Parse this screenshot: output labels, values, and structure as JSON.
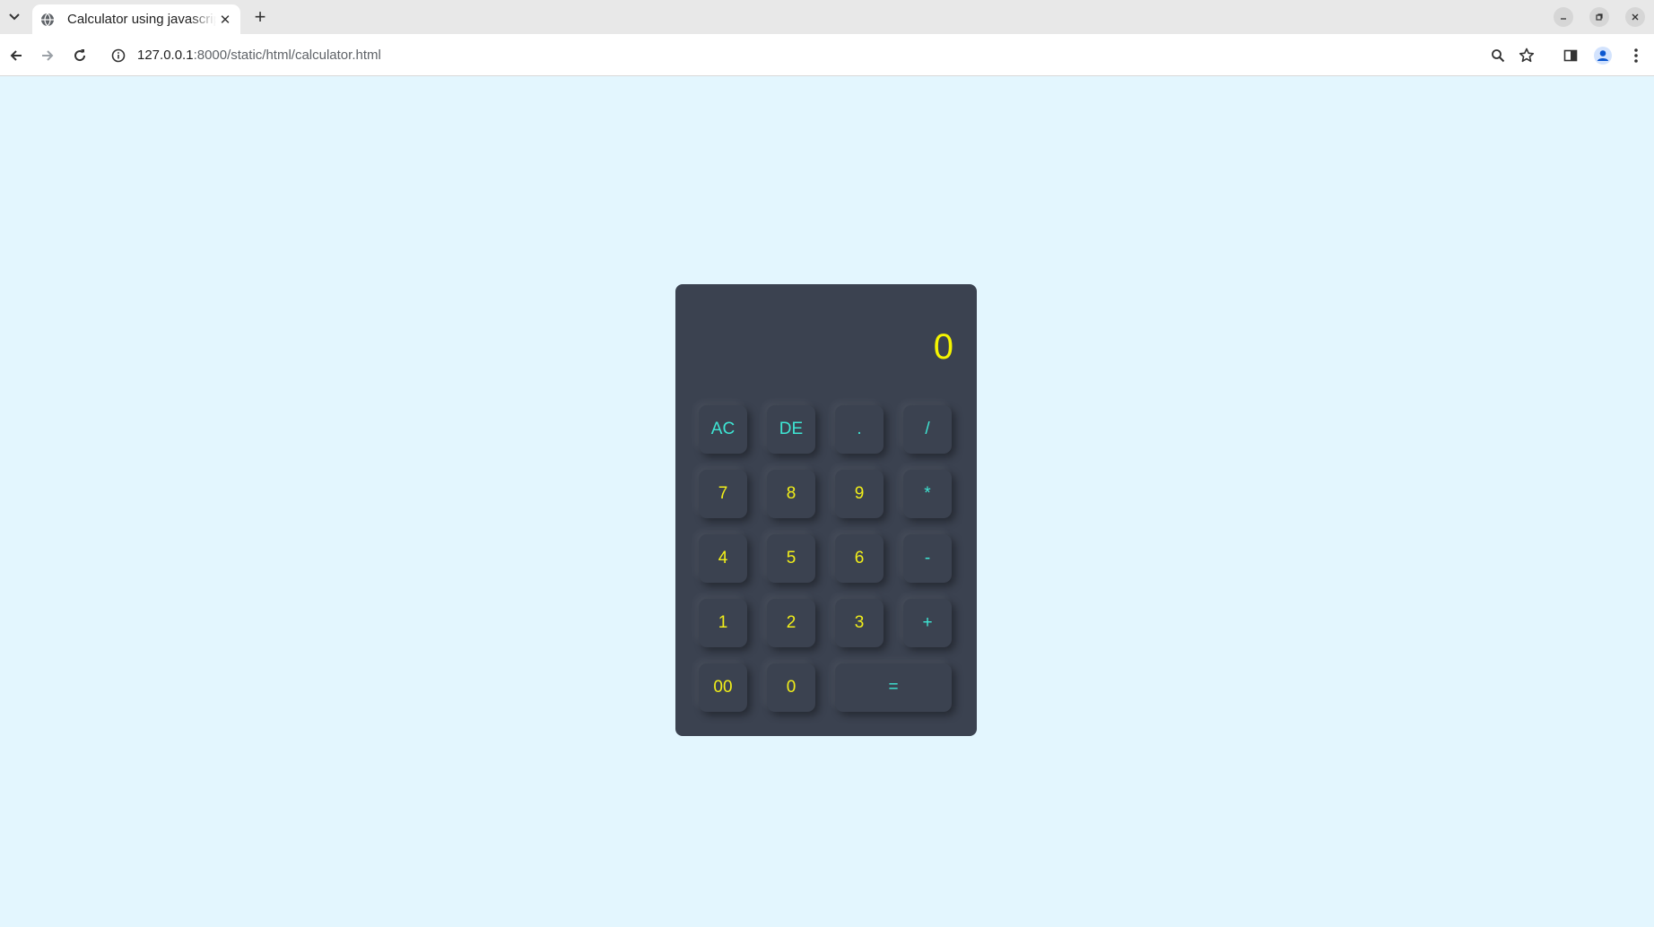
{
  "browser": {
    "tab_title": "Calculator using javascript",
    "close_glyph": "✕",
    "new_tab_glyph": "+",
    "url_host": "127.0.0.1",
    "url_rest": ":8000/static/html/calculator.html",
    "colors": {
      "tabbar": "#e8e8e8",
      "toolbar": "#ffffff",
      "page_bg": "#e3f6fe"
    }
  },
  "calculator": {
    "display_value": "0",
    "colors": {
      "body": "#3b4250",
      "digit": "#f2ef19",
      "operator": "#3ee6d4",
      "display": "#f5f500"
    },
    "rows": [
      [
        {
          "label": "AC",
          "kind": "op"
        },
        {
          "label": "DE",
          "kind": "op"
        },
        {
          "label": ".",
          "kind": "op"
        },
        {
          "label": "/",
          "kind": "op"
        }
      ],
      [
        {
          "label": "7",
          "kind": "num"
        },
        {
          "label": "8",
          "kind": "num"
        },
        {
          "label": "9",
          "kind": "num"
        },
        {
          "label": "*",
          "kind": "op"
        }
      ],
      [
        {
          "label": "4",
          "kind": "num"
        },
        {
          "label": "5",
          "kind": "num"
        },
        {
          "label": "6",
          "kind": "num"
        },
        {
          "label": "-",
          "kind": "op"
        }
      ],
      [
        {
          "label": "1",
          "kind": "num"
        },
        {
          "label": "2",
          "kind": "num"
        },
        {
          "label": "3",
          "kind": "num"
        },
        {
          "label": "+",
          "kind": "op"
        }
      ],
      [
        {
          "label": "00",
          "kind": "num"
        },
        {
          "label": "0",
          "kind": "num"
        },
        {
          "label": "=",
          "kind": "op"
        }
      ]
    ]
  }
}
